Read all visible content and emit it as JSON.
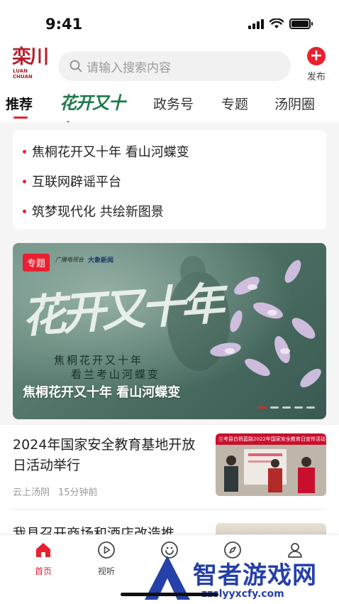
{
  "status_bar": {
    "time": "9:41"
  },
  "header": {
    "logo_cn": "栾川",
    "logo_en_1": "LUAN",
    "logo_en_2": "CHUAN",
    "search_placeholder": "请输入搜索内容",
    "publish_label": "发布"
  },
  "tabs": [
    {
      "label": "推荐",
      "active": true
    },
    {
      "label": "花开又十年",
      "kind": "brand"
    },
    {
      "label": "政务号"
    },
    {
      "label": "专题"
    },
    {
      "label": "汤阴圈"
    }
  ],
  "headlines": [
    "焦桐花开又十年 看山河蝶变",
    "互联网辟谣平台",
    "筑梦现代化 共绘新图景"
  ],
  "banner": {
    "tag": "专题",
    "source_1": "广播电视台",
    "source_2": "大象新闻",
    "calligraphy": "花开又十年",
    "subtitle_1": "焦桐花开又十年",
    "subtitle_2": "看兰考山河蝶变",
    "caption": "焦桐花开又十年 看山河蝶变",
    "slides_total": 5,
    "slide_active": 1
  },
  "news": [
    {
      "title": "2024年国家安全教育基地开放日活动举行",
      "source": "云上汤阴",
      "time": "15分钟前",
      "thumb_text": "兰考县白杨蓝路2022年国家安全教育日宣传活动"
    },
    {
      "title": "我县召开商场和酒店改造推"
    }
  ],
  "bottom_nav": [
    {
      "label": "首页",
      "icon": "home-icon",
      "active": true
    },
    {
      "label": "视听",
      "icon": "play-icon"
    },
    {
      "label": "办",
      "icon": "service-icon"
    },
    {
      "label": "",
      "icon": "compass-icon"
    },
    {
      "label": "",
      "icon": "user-icon"
    }
  ],
  "watermark": {
    "title": "智者游戏网",
    "url": "zzslyyxcfy.com"
  },
  "colors": {
    "accent": "#e8202f",
    "brand_green": "#1e7a4b",
    "watermark_blue": "#2540a8"
  }
}
